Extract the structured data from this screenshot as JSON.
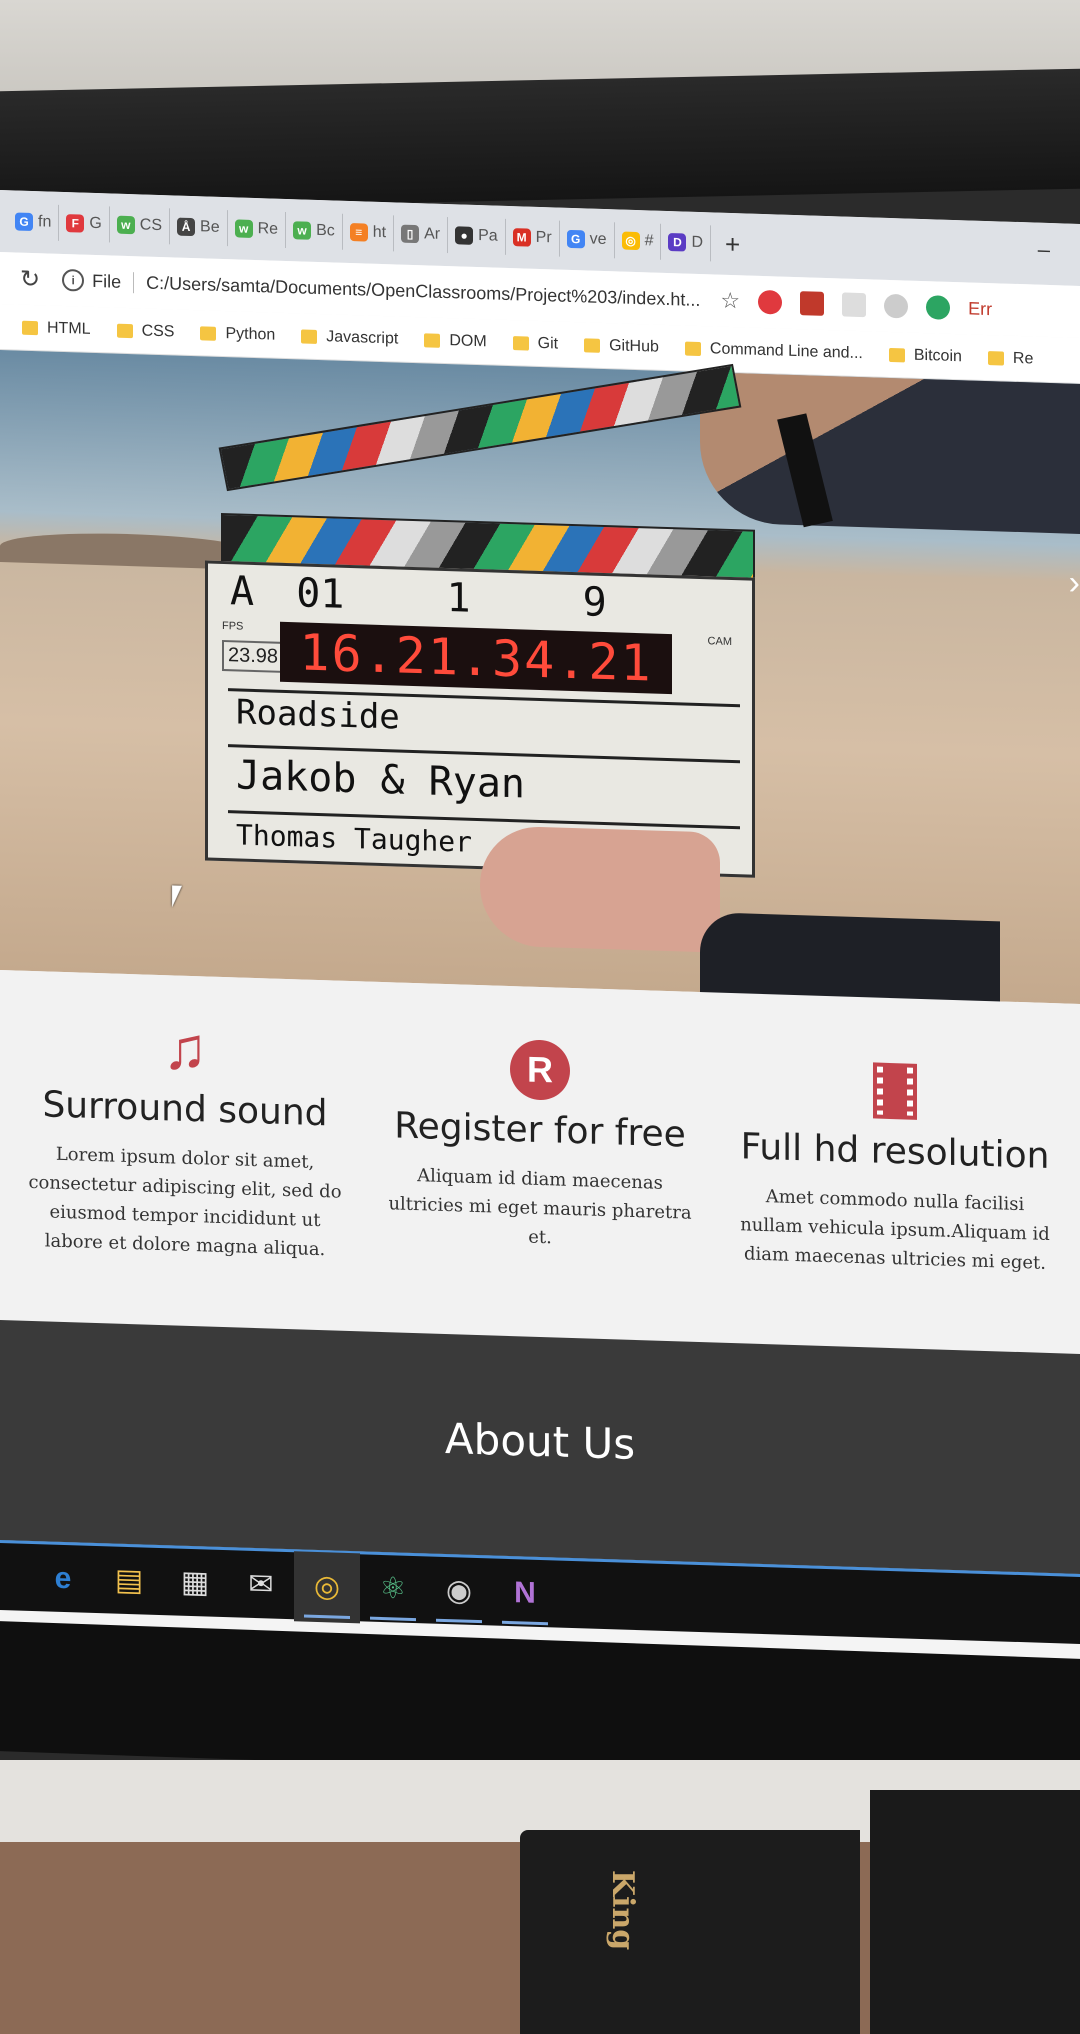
{
  "tabs": [
    {
      "label": "fn",
      "icon": "google-icon",
      "color": "#4285f4"
    },
    {
      "label": "G",
      "icon": "flipboard-icon",
      "color": "#e0393e"
    },
    {
      "label": "CS",
      "icon": "w3schools-icon",
      "color": "#4caf50"
    },
    {
      "label": "Be",
      "icon": "ap-icon",
      "color": "#444444"
    },
    {
      "label": "Re",
      "icon": "w3schools-icon",
      "color": "#4caf50"
    },
    {
      "label": "Bc",
      "icon": "w3schools-icon",
      "color": "#4caf50"
    },
    {
      "label": "ht",
      "icon": "stackoverflow-icon",
      "color": "#f48024"
    },
    {
      "label": "Ar",
      "icon": "document-icon",
      "color": "#777777"
    },
    {
      "label": "Pa",
      "icon": "github-icon",
      "color": "#333333"
    },
    {
      "label": "Pr",
      "icon": "gmail-icon",
      "color": "#d93025"
    },
    {
      "label": "ve",
      "icon": "google-icon",
      "color": "#4285f4"
    },
    {
      "label": "#",
      "icon": "chrome-icon",
      "color": "#fbbc05"
    },
    {
      "label": "D",
      "icon": "dashlane-icon",
      "color": "#5b3cc4"
    }
  ],
  "new_tab_label": "+",
  "minimize_label": "–",
  "address": {
    "file_label": "File",
    "url": "C:/Users/samta/Documents/OpenClassrooms/Project%203/index.ht...",
    "ext_label": "Err"
  },
  "bookmarks": [
    "HTML",
    "CSS",
    "Python",
    "Javascript",
    "DOM",
    "Git",
    "GitHub",
    "Command Line and...",
    "Bitcoin",
    "Re"
  ],
  "hero": {
    "slate_row": [
      "A",
      "01",
      "1",
      "9"
    ],
    "fps_label": "FPS",
    "fps_value": "23.98",
    "timecode": "16.21.34.21",
    "cam_label": "CAM",
    "prod": "Roadside",
    "director": "Jakob & Ryan",
    "camera": "Thomas Taugher"
  },
  "features": [
    {
      "icon": "music-note-icon",
      "title": "Surround sound",
      "text": "Lorem ipsum dolor sit amet, consectetur adipiscing elit, sed do eiusmod tempor incididunt ut labore et dolore magna aliqua."
    },
    {
      "icon": "register-icon",
      "title": "Register for free",
      "text": "Aliquam id diam maecenas ultricies mi eget mauris pharetra et."
    },
    {
      "icon": "film-icon",
      "title": "Full hd resolution",
      "text": "Amet commodo nulla facilisi nullam vehicula ipsum.Aliquam id diam maecenas ultricies mi eget."
    }
  ],
  "about": {
    "title": "About Us"
  },
  "taskbar": [
    {
      "icon": "edge-icon",
      "glyph": "e"
    },
    {
      "icon": "file-explorer-icon",
      "glyph": "▤"
    },
    {
      "icon": "store-icon",
      "glyph": "▦"
    },
    {
      "icon": "mail-icon",
      "glyph": "✉"
    },
    {
      "icon": "chrome-icon",
      "glyph": "◎"
    },
    {
      "icon": "atom-icon",
      "glyph": "⚛"
    },
    {
      "icon": "teamviewer-icon",
      "glyph": "◉"
    },
    {
      "icon": "onenote-icon",
      "glyph": "N"
    }
  ],
  "book_title": "King",
  "colors": {
    "accent": "#c2444c",
    "about_bg": "#3a3a3a"
  }
}
